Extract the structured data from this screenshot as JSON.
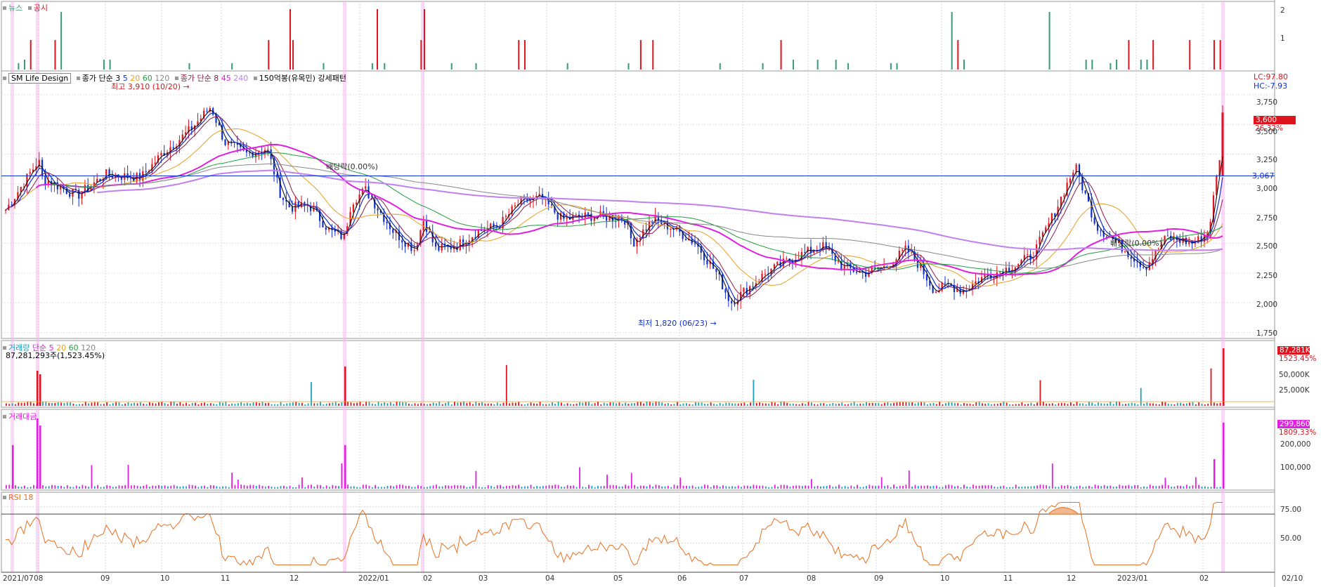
{
  "news_panel": {
    "title_news": "뉴스",
    "title_disclosure": "공시",
    "y_ticks": [
      "2",
      "1"
    ],
    "color_news": "#3a9a78",
    "color_disclosure": "#e0141e"
  },
  "price_panel": {
    "stock_name": "SM Life Design",
    "ma_price_label": "종가 단순",
    "ma_price_periods": [
      "3",
      "5",
      "20",
      "60",
      "120"
    ],
    "ma_price_colors": [
      "#000000",
      "#1030d0",
      "#e8a020",
      "#20a040",
      "#888888"
    ],
    "ma2_label": "종가 단순",
    "ma2_periods": [
      "8",
      "45",
      "240"
    ],
    "ma2_colors": [
      "#8b1a4a",
      "#e020e0",
      "#c080f0"
    ],
    "pattern_label": "150억봉(유목민)",
    "pattern_label2": "강세패턴",
    "high_note": "최고 3,910 (10/20)",
    "low_note": "최저 1,820 (06/23)",
    "dividend_note": "배당락(0.00%)",
    "dividend_note2": "배당락(0.00%)",
    "lc": "LC:97.80",
    "hc": "HC:-7.93",
    "current_price": "3,600",
    "current_change": "26.32%",
    "hline_value": "3,067",
    "y_ticks": [
      "3,750",
      "3,500",
      "3,250",
      "3,000",
      "2,750",
      "2,500",
      "2,250",
      "2,000",
      "1,750"
    ]
  },
  "volume_panel": {
    "title": "거래량",
    "ma_label": "단순",
    "ma_periods": [
      "5",
      "20",
      "60",
      "120"
    ],
    "ma_colors": [
      "#e020e0",
      "#e8a020",
      "#20a040",
      "#888888"
    ],
    "volume_text": "87,281,293주(1,523.45%)",
    "current_value": "87,281K",
    "current_pct": "1523.45%",
    "y_ticks": [
      "50,000K",
      "25,000K"
    ]
  },
  "amount_panel": {
    "title": "거래대금",
    "current_value": "299,860",
    "current_pct": "1809.33%",
    "y_ticks": [
      "200,000",
      "100,000"
    ]
  },
  "rsi_panel": {
    "title": "RSI 18",
    "y_ticks": [
      "75.00",
      "50.00"
    ]
  },
  "x_axis": {
    "labels": [
      "2021/07",
      "08",
      "09",
      "10",
      "11",
      "12",
      "2022/01",
      "02",
      "03",
      "04",
      "05",
      "06",
      "07",
      "08",
      "09",
      "10",
      "11",
      "12",
      "2023/01",
      "02",
      "02/10"
    ]
  },
  "chart_data": {
    "type": "candlestick",
    "title": "SM Life Design",
    "ylim": [
      1700,
      3950
    ],
    "x": [
      "2021/07",
      "2021/08",
      "2021/09",
      "2021/10",
      "2021/11",
      "2021/12",
      "2022/01",
      "2022/02",
      "2022/03",
      "2022/04",
      "2022/05",
      "2022/06",
      "2022/07",
      "2022/08",
      "2022/09",
      "2022/10",
      "2022/11",
      "2022/12",
      "2023/01",
      "2023/02"
    ],
    "close_approx": [
      2780,
      3100,
      3080,
      3650,
      3220,
      2550,
      2880,
      2420,
      2870,
      2750,
      2720,
      2200,
      2150,
      2420,
      2250,
      2050,
      2280,
      3180,
      2350,
      3600
    ],
    "high": 3910,
    "high_date": "10/20",
    "low": 1820,
    "low_date": "06/23",
    "reference_line": 3067,
    "last_close": 3600,
    "last_change_pct": 26.32,
    "last_volume_k": 87281,
    "rsi_ylim": [
      30,
      85
    ],
    "rsi_levels": [
      70,
      30
    ]
  }
}
